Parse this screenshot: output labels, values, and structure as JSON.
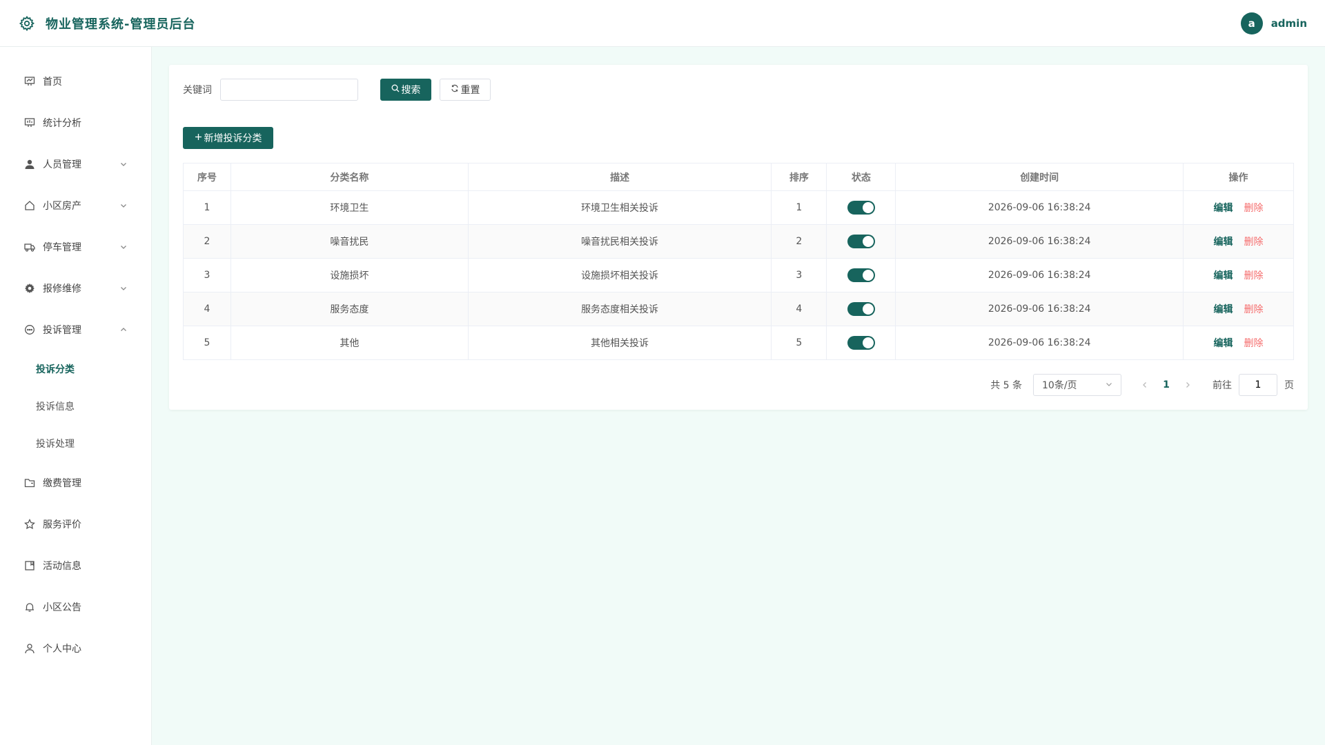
{
  "header": {
    "title": "物业管理系统-管理员后台",
    "avatar_letter": "a",
    "username": "admin"
  },
  "sidebar": {
    "items": [
      {
        "label": "首页",
        "icon": "presentation-icon"
      },
      {
        "label": "统计分析",
        "icon": "presentation-icon"
      },
      {
        "label": "人员管理",
        "icon": "user-icon"
      },
      {
        "label": "小区房产",
        "icon": "home-icon"
      },
      {
        "label": "停车管理",
        "icon": "truck-icon"
      },
      {
        "label": "报修维修",
        "icon": "gear-icon"
      },
      {
        "label": "投诉管理",
        "icon": "chat-icon"
      },
      {
        "label": "缴费管理",
        "icon": "folder-icon"
      },
      {
        "label": "服务评价",
        "icon": "star-icon"
      },
      {
        "label": "活动信息",
        "icon": "notebook-icon"
      },
      {
        "label": "小区公告",
        "icon": "bell-icon"
      },
      {
        "label": "个人中心",
        "icon": "user-outline-icon"
      }
    ],
    "sub_items": [
      "投诉分类",
      "投诉信息",
      "投诉处理"
    ]
  },
  "search": {
    "label": "关键词",
    "value": "",
    "placeholder": "",
    "search_button": "搜索",
    "reset_button": "重置"
  },
  "add_button": "新增投诉分类",
  "table": {
    "columns": [
      "序号",
      "分类名称",
      "描述",
      "排序",
      "状态",
      "创建时间",
      "操作"
    ],
    "rows": [
      {
        "index": "1",
        "name": "环境卫生",
        "desc": "环境卫生相关投诉",
        "sort": "1",
        "status": true,
        "created": "2026-09-06 16:38:24"
      },
      {
        "index": "2",
        "name": "噪音扰民",
        "desc": "噪音扰民相关投诉",
        "sort": "2",
        "status": true,
        "created": "2026-09-06 16:38:24"
      },
      {
        "index": "3",
        "name": "设施损坏",
        "desc": "设施损坏相关投诉",
        "sort": "3",
        "status": true,
        "created": "2026-09-06 16:38:24"
      },
      {
        "index": "4",
        "name": "服务态度",
        "desc": "服务态度相关投诉",
        "sort": "4",
        "status": true,
        "created": "2026-09-06 16:38:24"
      },
      {
        "index": "5",
        "name": "其他",
        "desc": "其他相关投诉",
        "sort": "5",
        "status": true,
        "created": "2026-09-06 16:38:24"
      }
    ],
    "edit_label": "编辑",
    "delete_label": "删除"
  },
  "pagination": {
    "total": "共 5 条",
    "page_size": "10条/页",
    "current_page": "1",
    "goto_label": "前往",
    "goto_value": "1",
    "page_suffix": "页"
  },
  "colors": {
    "primary": "#17645d",
    "danger": "#f56c6c",
    "background": "#f1fbf8"
  }
}
